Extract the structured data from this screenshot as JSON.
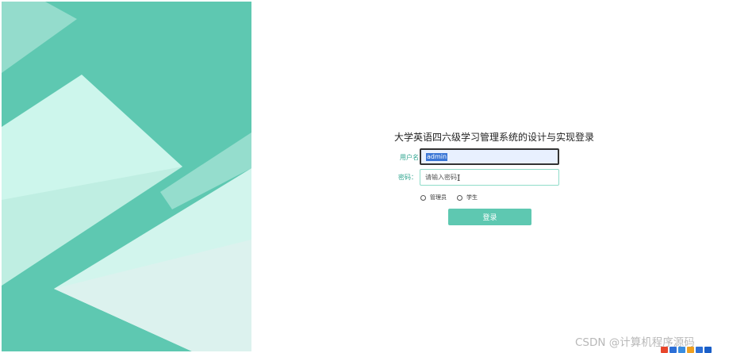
{
  "login": {
    "title": "大学英语四六级学习管理系统的设计与实现登录",
    "username_label": "用户名",
    "username_value": "admin",
    "password_label": "密码：",
    "password_placeholder": "请输入密码",
    "roles": [
      {
        "label": "管理员",
        "checked": false
      },
      {
        "label": "学生",
        "checked": false
      }
    ],
    "submit_label": "登录"
  },
  "watermark": "CSDN @计算机程序源码",
  "colors": {
    "accent": "#5ec8b1",
    "label": "#2fa58f",
    "panel_light": "#c8f5ea",
    "input_border": "#8fdcc9"
  },
  "icons": {
    "cursor": "text-cursor-icon",
    "radio": "radio-icon",
    "tray": "system-tray-icons"
  }
}
